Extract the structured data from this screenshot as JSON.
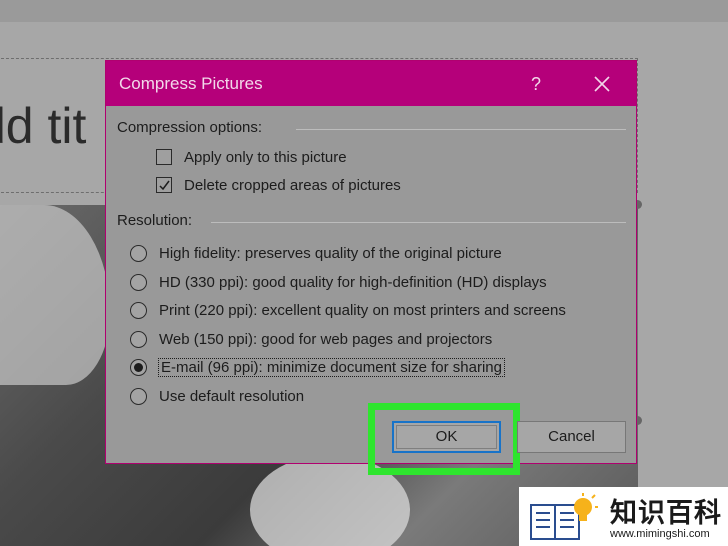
{
  "slide": {
    "title_fragment": "dd tit"
  },
  "dialog": {
    "title": "Compress Pictures",
    "help_label": "?",
    "close_icon": "close-icon",
    "compression_header": "Compression options:",
    "options": [
      {
        "label": "Apply only to this picture",
        "checked": false
      },
      {
        "label": "Delete cropped areas of pictures",
        "checked": true
      }
    ],
    "resolution_header": "Resolution:",
    "resolutions": [
      {
        "label": "High fidelity: preserves quality of the original picture",
        "selected": false
      },
      {
        "label": "HD (330 ppi): good quality for high-definition (HD) displays",
        "selected": false
      },
      {
        "label": "Print (220 ppi): excellent quality on most printers and screens",
        "selected": false
      },
      {
        "label": "Web (150 ppi): good for web pages and projectors",
        "selected": false
      },
      {
        "label": "E-mail (96 ppi): minimize document size for sharing",
        "selected": true
      },
      {
        "label": "Use default resolution",
        "selected": false
      }
    ],
    "ok_label": "OK",
    "cancel_label": "Cancel",
    "colors": {
      "titlebar": "#b5007a",
      "highlight": "#2ee52e",
      "focus_border": "#1873c8"
    }
  },
  "watermark": {
    "title": "知识百科",
    "url": "www.mimingshi.com",
    "icon": "book-lightbulb-logo"
  }
}
